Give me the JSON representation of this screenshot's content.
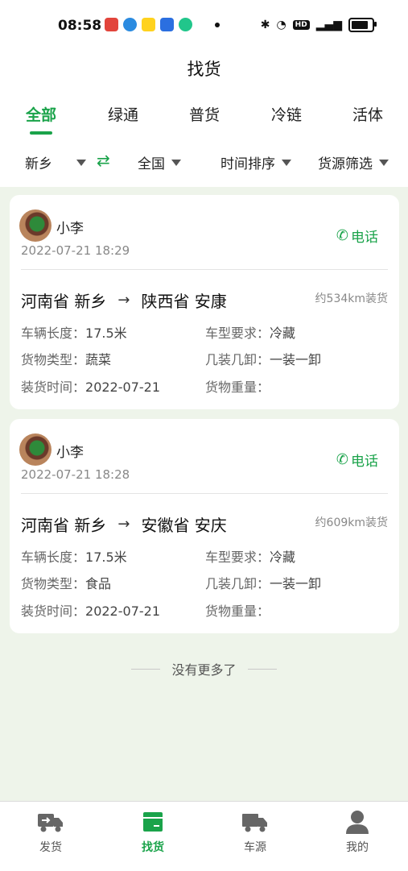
{
  "status_bar": {
    "time": "08:58"
  },
  "header": {
    "title": "找货"
  },
  "tabs": [
    {
      "label": "全部"
    },
    {
      "label": "绿通"
    },
    {
      "label": "普货"
    },
    {
      "label": "冷链"
    },
    {
      "label": "活体"
    }
  ],
  "filters": {
    "origin": "新乡",
    "destination": "全国",
    "sort": "时间排序",
    "source_filter": "货源筛选"
  },
  "cards": [
    {
      "user": "小李",
      "time": "2022-07-21 18:29",
      "call_label": "电话",
      "from": "河南省 新乡",
      "to": "陕西省 安康",
      "distance": "约534km装货",
      "length_label": "车辆长度：",
      "length": "17.5米",
      "type_label": "车型要求：",
      "type": "冷藏",
      "goods_label": "货物类型：",
      "goods": "蔬菜",
      "load_label": "几装几卸：",
      "load": "一装一卸",
      "date_label": "装货时间：",
      "date": "2022-07-21",
      "weight_label": "货物重量：",
      "weight": ""
    },
    {
      "user": "小李",
      "time": "2022-07-21 18:28",
      "call_label": "电话",
      "from": "河南省 新乡",
      "to": "安徽省 安庆",
      "distance": "约609km装货",
      "length_label": "车辆长度：",
      "length": "17.5米",
      "type_label": "车型要求：",
      "type": "冷藏",
      "goods_label": "货物类型：",
      "goods": "食品",
      "load_label": "几装几卸：",
      "load": "一装一卸",
      "date_label": "装货时间：",
      "date": "2022-07-21",
      "weight_label": "货物重量：",
      "weight": ""
    }
  ],
  "list_end": "没有更多了",
  "bottom_nav": [
    {
      "label": "发货",
      "icon": "truck-send-icon"
    },
    {
      "label": "找货",
      "icon": "box-icon"
    },
    {
      "label": "车源",
      "icon": "truck-icon"
    },
    {
      "label": "我的",
      "icon": "user-icon"
    }
  ],
  "colors": {
    "accent": "#1aa34a",
    "background": "#eef4ea"
  }
}
